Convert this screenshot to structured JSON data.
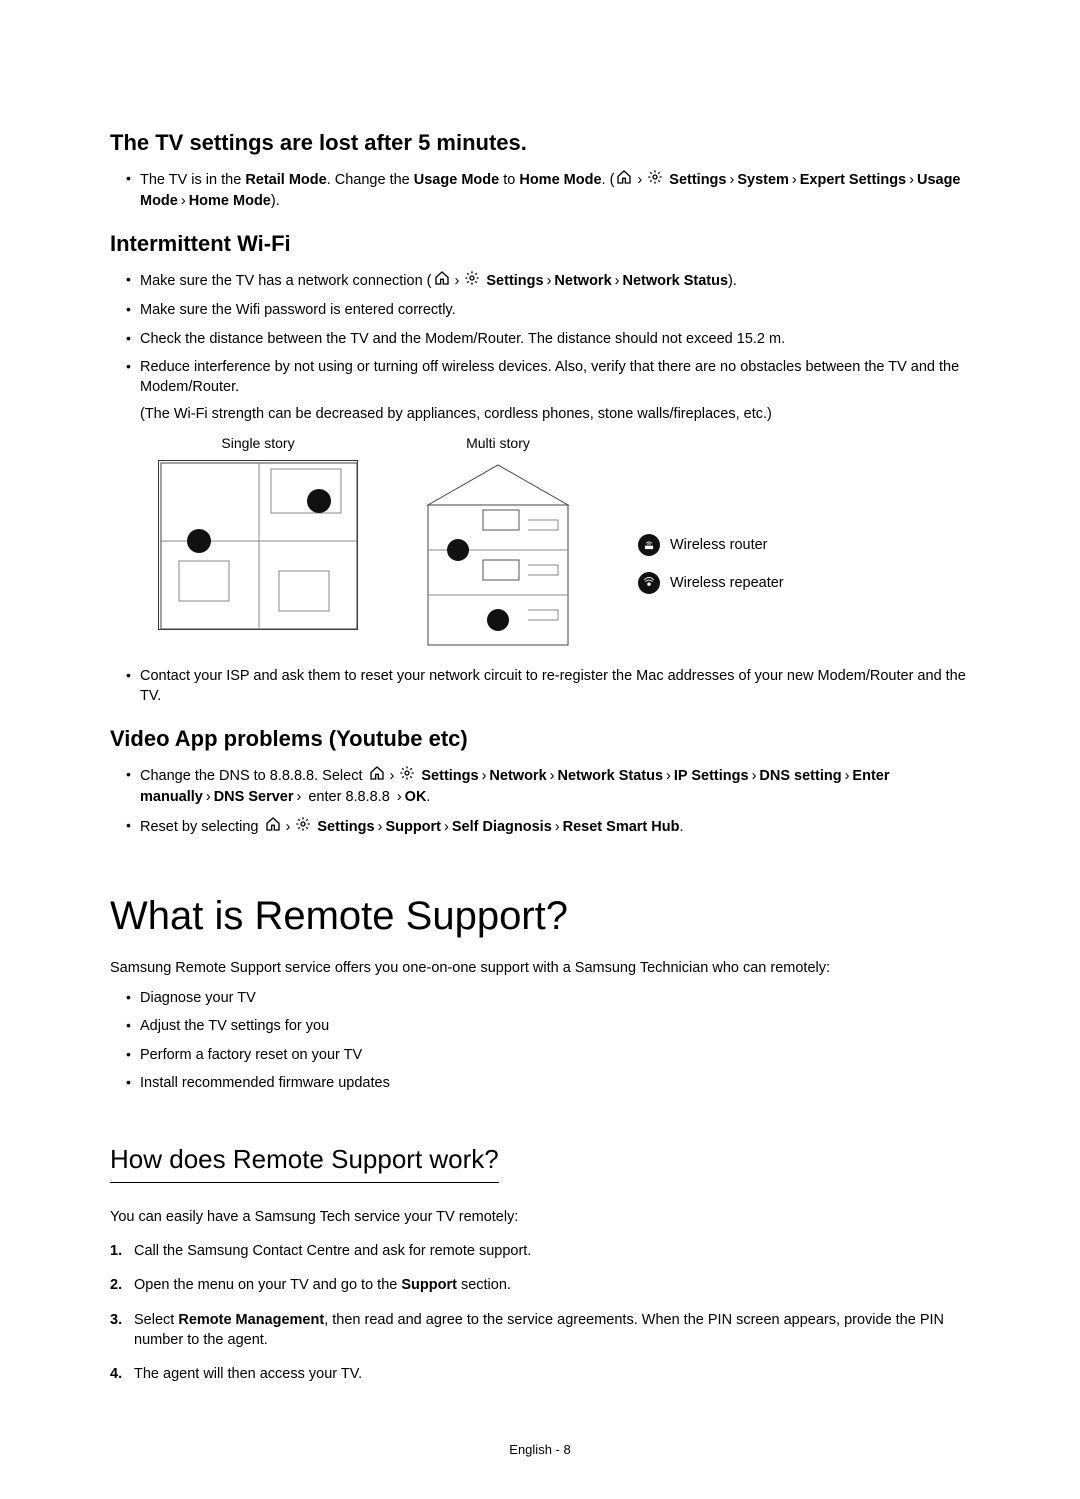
{
  "footer": "English - 8",
  "icons": {
    "home": "home-icon",
    "gear": "gear-icon"
  },
  "section_tv_settings": {
    "heading": "The TV settings are lost after 5 minutes.",
    "bullet1_pre": "The TV is in the ",
    "bullet1_retail": "Retail Mode",
    "bullet1_mid1": ". Change the ",
    "bullet1_usage": "Usage Mode",
    "bullet1_mid2": " to ",
    "bullet1_home": "Home Mode",
    "bullet1_mid3": ". (",
    "path1_settings": "Settings",
    "path1_system": "System",
    "path1_expert": "Expert Settings",
    "path1_usage": "Usage Mode",
    "path1_home": "Home Mode",
    "bullet1_end": ")."
  },
  "section_wifi": {
    "heading": "Intermittent Wi-Fi",
    "b1_pre": "Make sure the TV has a network connection (",
    "b1_settings": "Settings",
    "b1_network": "Network",
    "b1_status": "Network Status",
    "b1_end": ").",
    "b2": "Make sure the Wifi password is entered correctly.",
    "b3": "Check the distance between the TV and the Modem/Router. The distance should not exceed 15.2 m.",
    "b4": "Reduce interference by not using or turning off wireless devices. Also, verify that there are no obstacles between the TV and the Modem/Router.",
    "b4_sub": "(The Wi-Fi strength can be decreased by appliances, cordless phones, stone walls/fireplaces, etc.)",
    "single_caption": "Single story",
    "multi_caption": "Multi story",
    "legend_router": "Wireless router",
    "legend_repeater": "Wireless repeater",
    "b5": "Contact your ISP and ask them to reset your network circuit to re-register the Mac addresses of your new Modem/Router and the TV."
  },
  "section_video": {
    "heading": "Video App problems (Youtube etc)",
    "b1_pre": "Change the DNS to 8.8.8.8. Select ",
    "b1_settings": "Settings",
    "b1_network": "Network",
    "b1_status": "Network Status",
    "b1_ip": "IP Settings",
    "b1_dns": "DNS setting",
    "b1_enter": "Enter manually",
    "b1_server": "DNS Server",
    "b1_val": " enter 8.8.8.8 ",
    "b1_ok": "OK",
    "b1_end": ".",
    "b2_pre": "Reset by selecting ",
    "b2_settings": "Settings",
    "b2_support": "Support",
    "b2_selfdiag": "Self Diagnosis",
    "b2_reset": "Reset Smart Hub",
    "b2_end": "."
  },
  "section_remote": {
    "heading": "What is Remote Support?",
    "intro": "Samsung Remote Support service offers you one-on-one support with a Samsung Technician who can remotely:",
    "b1": "Diagnose your TV",
    "b2": "Adjust the TV settings for you",
    "b3": "Perform a factory reset on your TV",
    "b4": "Install recommended firmware updates"
  },
  "section_how": {
    "heading": "How does Remote Support work?",
    "intro": "You can easily have a Samsung Tech service your TV remotely:",
    "s1_num": "1.",
    "s1": "Call the Samsung Contact Centre and ask for remote support.",
    "s2_num": "2.",
    "s2_pre": "Open the menu on your TV and go to the ",
    "s2_bold": "Support",
    "s2_post": " section.",
    "s3_num": "3.",
    "s3_pre": "Select ",
    "s3_bold": "Remote Management",
    "s3_post": ", then read and agree to the service agreements. When the PIN screen appears, provide the PIN number to the agent.",
    "s4_num": "4.",
    "s4": "The agent will then access your TV."
  }
}
